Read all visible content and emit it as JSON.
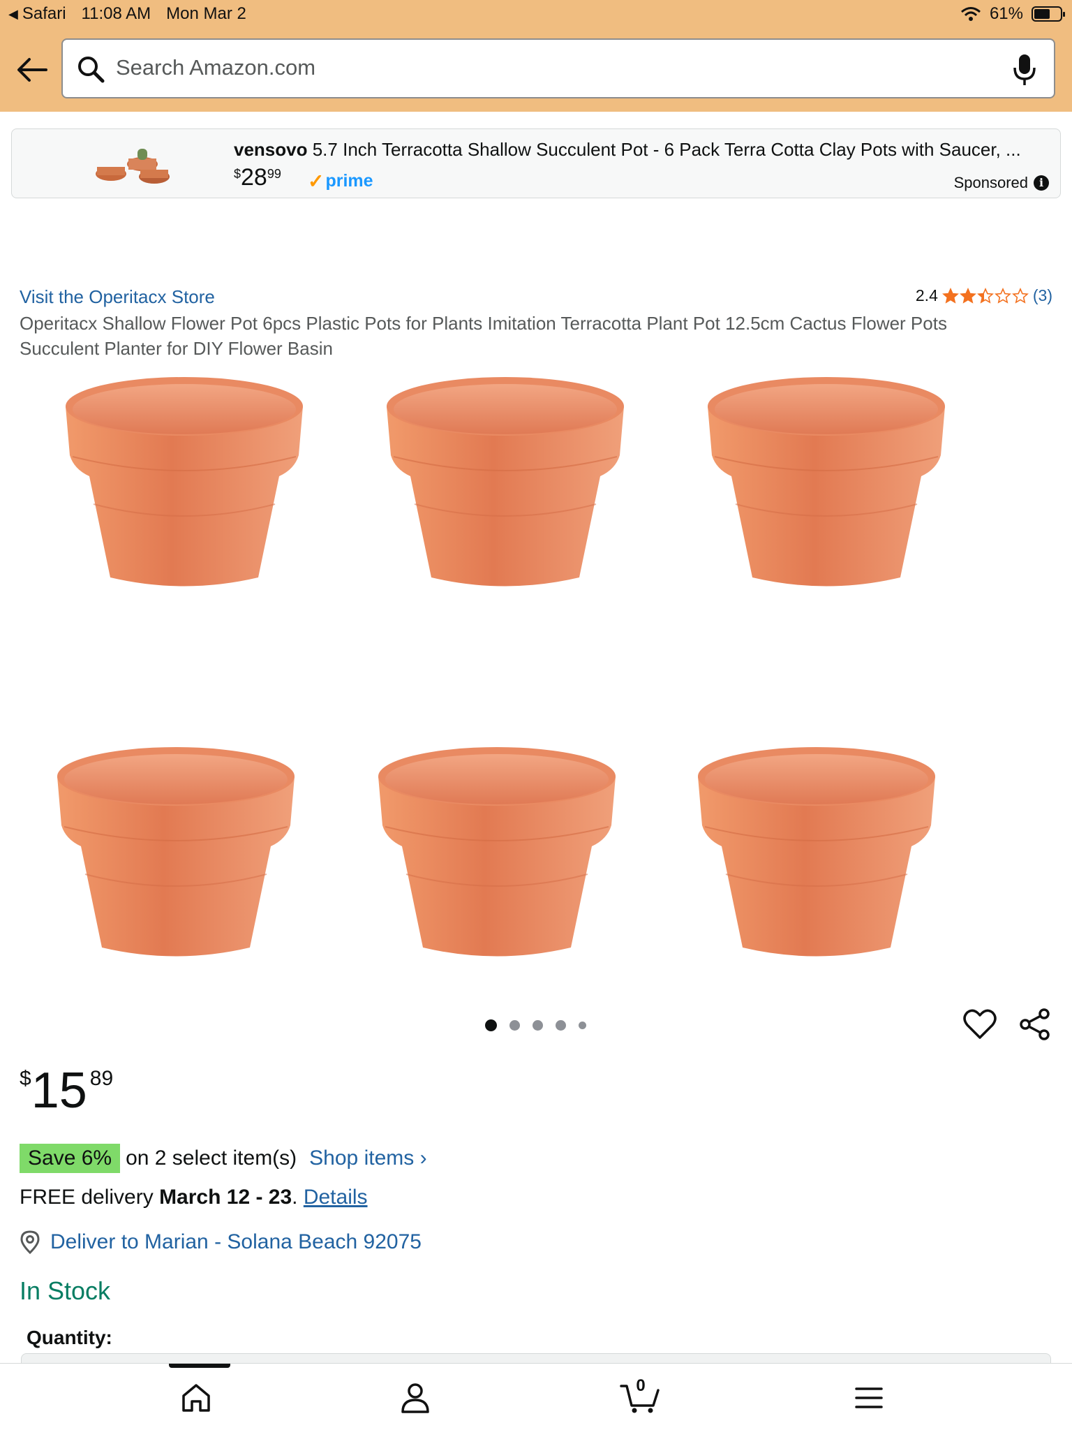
{
  "status_bar": {
    "back_app": "Safari",
    "time": "11:08 AM",
    "date": "Mon Mar 2",
    "battery": "61%",
    "battery_level": 0.61
  },
  "search": {
    "placeholder": "Search Amazon.com"
  },
  "sponsored_ad": {
    "brand": "vensovo",
    "title": " 5.7 Inch Terracotta Shallow Succulent Pot - 6 Pack Terra Cotta Clay Pots with Saucer, ...",
    "price_symbol": "$",
    "price_whole": "28",
    "price_fraction": "99",
    "prime_label": "prime",
    "sponsored_label": "Sponsored"
  },
  "product": {
    "store_link": "Visit the Operitacx Store",
    "rating_value": "2.4",
    "rating_stars": 2.4,
    "rating_count": "(3)",
    "title": "Operitacx Shallow Flower Pot 6pcs Plastic Pots for Plants Imitation Terracotta Plant Pot 12.5cm Cactus Flower Pots Succulent Planter for DIY Flower Basin",
    "image_count": 5,
    "active_image": 1
  },
  "price": {
    "symbol": "$",
    "whole": "15",
    "fraction": "89"
  },
  "promo": {
    "badge": "Save 6%",
    "text": "on 2 select item(s)",
    "link": "Shop items ›"
  },
  "delivery": {
    "prefix": "FREE delivery ",
    "dates": "March 12 - 23",
    "separator": ". ",
    "details_link": "Details"
  },
  "deliver_to": "Deliver to Marian - Solana Beach 92075",
  "availability": "In Stock",
  "quantity_label": "Quantity:",
  "tabbar": {
    "cart_count": "0"
  },
  "colors": {
    "header_bg": "#f0bd80",
    "link": "#2162a1",
    "in_stock": "#067d62",
    "save_badge": "#7fda69",
    "star": "#f3711f",
    "pot": "#e8875e"
  }
}
